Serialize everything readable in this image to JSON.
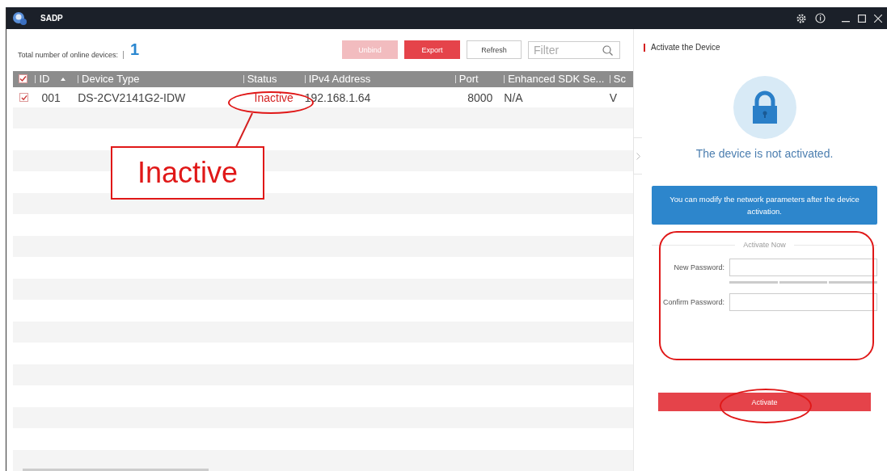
{
  "window": {
    "title": "SADP"
  },
  "toolbar": {
    "online_label": "Total number of online devices:",
    "online_count": "1",
    "buttons": [
      {
        "label": "Unbind",
        "disabled": true,
        "kind": "primary"
      },
      {
        "label": "Export",
        "disabled": false,
        "kind": "primary"
      },
      {
        "label": "Refresh",
        "disabled": false,
        "kind": "plain"
      }
    ],
    "filter": {
      "placeholder": "Filter"
    }
  },
  "table": {
    "header_checked": true,
    "columns": [
      "ID",
      "Device Type",
      "Status",
      "IPv4 Address",
      "Port",
      "Enhanced SDK Se...",
      "Sc"
    ],
    "rows": [
      {
        "checked": true,
        "cells": [
          "001",
          "DS-2CV2141G2-IDW",
          "Inactive",
          "192.168.1.64",
          "8000",
          "N/A",
          "V"
        ]
      }
    ]
  },
  "panel": {
    "title": "Activate the Device",
    "message": "The device is not activated.",
    "tip": "You can modify the network parameters after the device activation.",
    "section": "Activate Now",
    "fields": [
      {
        "label": "New Password:",
        "kind": "strength"
      },
      {
        "label": "Confirm Password:",
        "kind": "plain"
      }
    ],
    "button": "Activate"
  },
  "annotations": {
    "callout": "Inactive"
  }
}
